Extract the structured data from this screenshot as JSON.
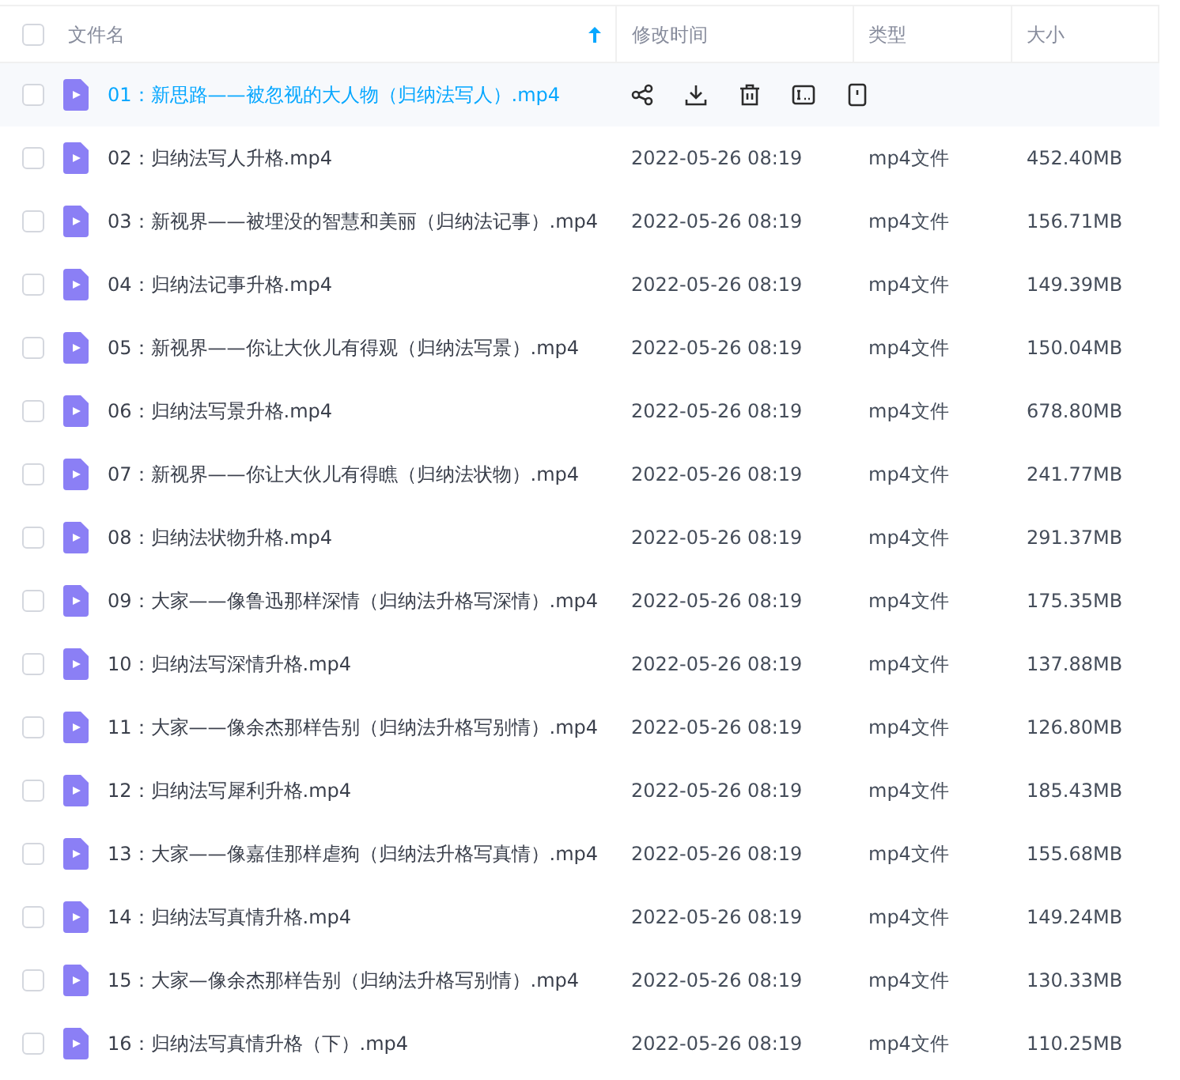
{
  "table": {
    "all_checked": false,
    "columns": [
      {
        "label": "文件名",
        "sorted": true
      },
      {
        "label": "修改时间",
        "sorted": false
      },
      {
        "label": "类型",
        "sorted": false
      },
      {
        "label": "大小",
        "sorted": false
      }
    ],
    "rows": [
      {
        "name": "01：新思路——被忽视的大人物（归纳法写人）.mp4",
        "hovered": true,
        "checked": false
      },
      {
        "name": "02：归纳法写人升格.mp4",
        "modified": "2022-05-26 08:19",
        "type": "mp4文件",
        "size": "452.40MB",
        "hovered": false,
        "checked": false
      },
      {
        "name": "03：新视界——被埋没的智慧和美丽（归纳法记事）.mp4",
        "modified": "2022-05-26 08:19",
        "type": "mp4文件",
        "size": "156.71MB",
        "hovered": false,
        "checked": false
      },
      {
        "name": "04：归纳法记事升格.mp4",
        "modified": "2022-05-26 08:19",
        "type": "mp4文件",
        "size": "149.39MB",
        "hovered": false,
        "checked": false
      },
      {
        "name": "05：新视界——你让大伙儿有得观（归纳法写景）.mp4",
        "modified": "2022-05-26 08:19",
        "type": "mp4文件",
        "size": "150.04MB",
        "hovered": false,
        "checked": false
      },
      {
        "name": "06：归纳法写景升格.mp4",
        "modified": "2022-05-26 08:19",
        "type": "mp4文件",
        "size": "678.80MB",
        "hovered": false,
        "checked": false
      },
      {
        "name": "07：新视界——你让大伙儿有得瞧（归纳法状物）.mp4",
        "modified": "2022-05-26 08:19",
        "type": "mp4文件",
        "size": "241.77MB",
        "hovered": false,
        "checked": false
      },
      {
        "name": "08：归纳法状物升格.mp4",
        "modified": "2022-05-26 08:19",
        "type": "mp4文件",
        "size": "291.37MB",
        "hovered": false,
        "checked": false
      },
      {
        "name": "09：大家——像鲁迅那样深情（归纳法升格写深情）.mp4",
        "modified": "2022-05-26 08:19",
        "type": "mp4文件",
        "size": "175.35MB",
        "hovered": false,
        "checked": false
      },
      {
        "name": "10：归纳法写深情升格.mp4",
        "modified": "2022-05-26 08:19",
        "type": "mp4文件",
        "size": "137.88MB",
        "hovered": false,
        "checked": false
      },
      {
        "name": "11：大家——像余杰那样告别（归纳法升格写别情）.mp4",
        "modified": "2022-05-26 08:19",
        "type": "mp4文件",
        "size": "126.80MB",
        "hovered": false,
        "checked": false
      },
      {
        "name": "12：归纳法写犀利升格.mp4",
        "modified": "2022-05-26 08:19",
        "type": "mp4文件",
        "size": "185.43MB",
        "hovered": false,
        "checked": false
      },
      {
        "name": "13：大家——像嘉佳那样虐狗（归纳法升格写真情）.mp4",
        "modified": "2022-05-26 08:19",
        "type": "mp4文件",
        "size": "155.68MB",
        "hovered": false,
        "checked": false
      },
      {
        "name": "14：归纳法写真情升格.mp4",
        "modified": "2022-05-26 08:19",
        "type": "mp4文件",
        "size": "149.24MB",
        "hovered": false,
        "checked": false
      },
      {
        "name": "15：大家—像余杰那样告别（归纳法升格写别情）.mp4",
        "modified": "2022-05-26 08:19",
        "type": "mp4文件",
        "size": "130.33MB",
        "hovered": false,
        "checked": false
      },
      {
        "name": "16：归纳法写真情升格（下）.mp4",
        "modified": "2022-05-26 08:19",
        "type": "mp4文件",
        "size": "110.25MB",
        "hovered": false,
        "checked": false
      }
    ]
  }
}
